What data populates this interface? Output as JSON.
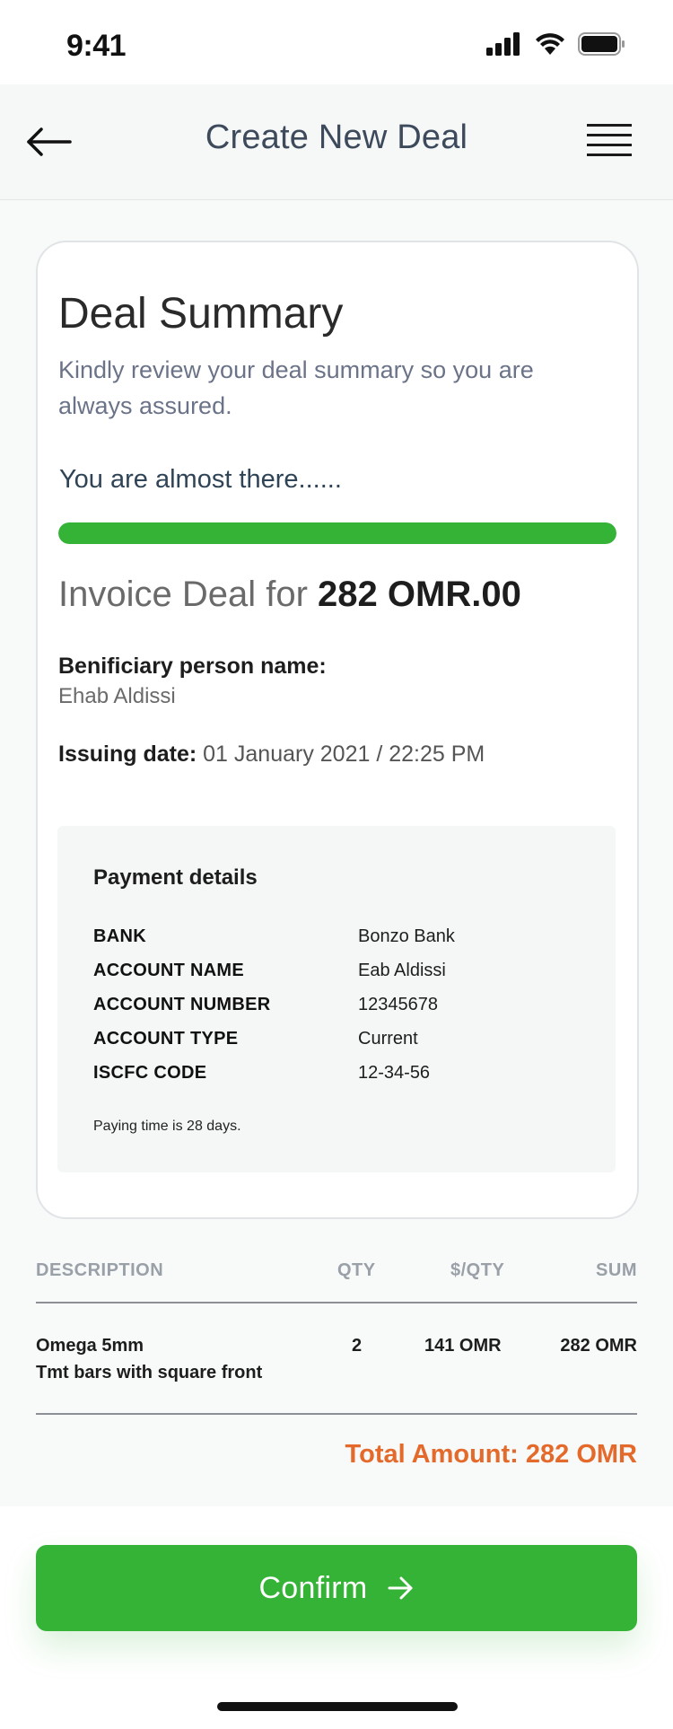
{
  "status_bar": {
    "time": "9:41"
  },
  "header": {
    "title": "Create New Deal"
  },
  "summary": {
    "title": "Deal Summary",
    "subtitle": "Kindly review your deal summary so you are always assured.",
    "progress_label": "You are almost there......",
    "progress_fraction": 1.0,
    "invoice_prefix": "Invoice Deal for ",
    "invoice_amount": "282 OMR.00",
    "beneficiary_label": "Benificiary person name:",
    "beneficiary_value": "Ehab Aldissi",
    "issuing_label": "Issuing date:",
    "issuing_value": " 01 January 2021 / 22:25 PM"
  },
  "payment": {
    "title": "Payment details",
    "rows": [
      {
        "key": "BANK",
        "value": "Bonzo Bank"
      },
      {
        "key": "ACCOUNT NAME",
        "value": "Eab Aldissi"
      },
      {
        "key": "ACCOUNT NUMBER",
        "value": "12345678"
      },
      {
        "key": "ACCOUNT TYPE",
        "value": "Current"
      },
      {
        "key": "ISCFC CODE",
        "value": "12-34-56"
      }
    ],
    "note": "Paying time is 28 days."
  },
  "table": {
    "headers": [
      "DESCRIPTION",
      "QTY",
      "$/QTY",
      "SUM"
    ],
    "rows": [
      {
        "description_line1": "Omega 5mm",
        "description_line2": "Tmt bars with square front",
        "qty": "2",
        "unit_price": "141 OMR",
        "sum": "282 OMR"
      }
    ],
    "total": "Total Amount: 282 OMR"
  },
  "actions": {
    "confirm_label": "Confirm"
  },
  "colors": {
    "accent_green": "#35b337",
    "total_orange": "#e46a2c",
    "title_slate": "#3d4a5c"
  },
  "icons": [
    "back-arrow-icon",
    "hamburger-menu-icon",
    "signal-icon",
    "wifi-icon",
    "battery-icon",
    "arrow-right-icon"
  ]
}
